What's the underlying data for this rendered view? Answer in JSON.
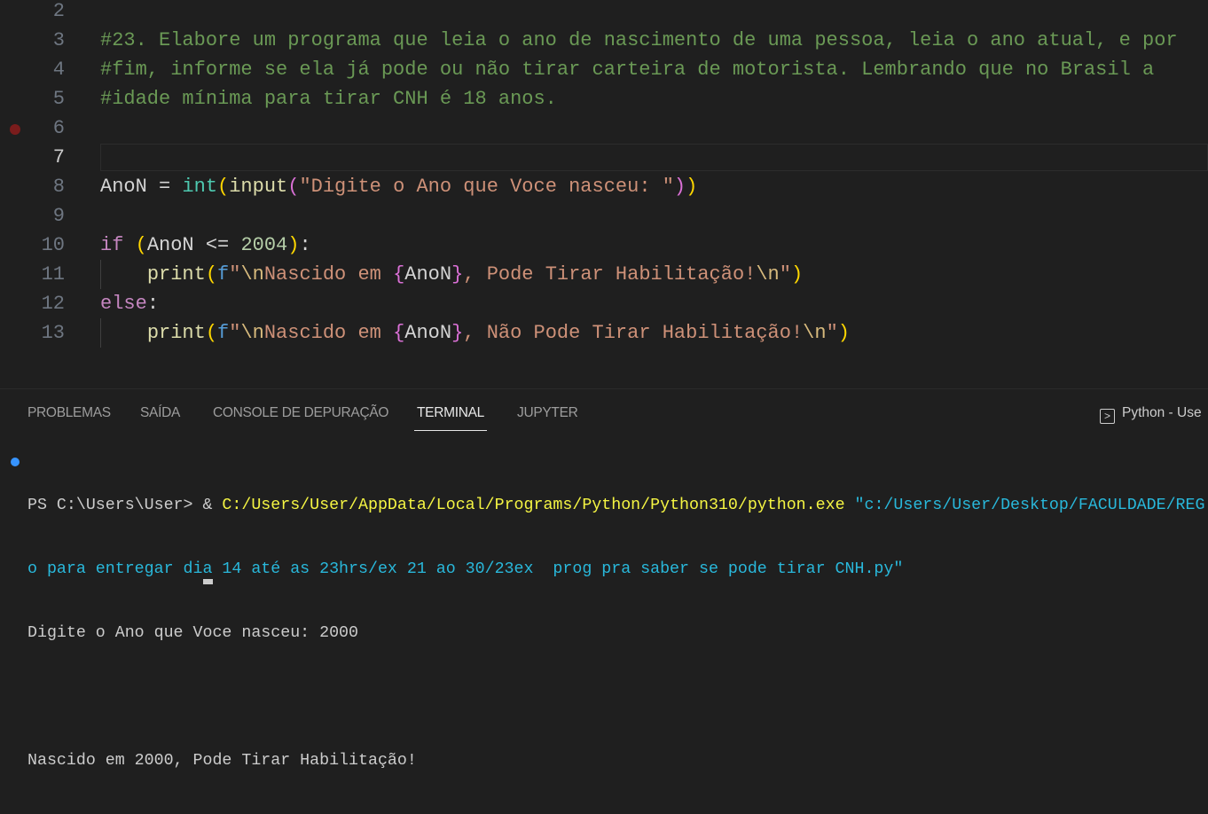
{
  "editor": {
    "active_line": 7,
    "breakpoint_line": 6,
    "lines": [
      {
        "n": "2",
        "tokens": []
      },
      {
        "n": "3",
        "tokens": [
          [
            "#23. Elabore um programa que leia o ano de nascimento de uma pessoa, leia o ano atual, e por",
            "comment"
          ]
        ]
      },
      {
        "n": "4",
        "tokens": [
          [
            "#fim, informe se ela já pode ou não tirar carteira de motorista. Lembrando que no Brasil a",
            "comment"
          ]
        ]
      },
      {
        "n": "5",
        "tokens": [
          [
            "#idade mínima para tirar CNH é 18 anos.",
            "comment"
          ]
        ]
      },
      {
        "n": "6",
        "tokens": []
      },
      {
        "n": "7",
        "tokens": []
      },
      {
        "n": "8",
        "tokens": [
          [
            "AnoN",
            "var"
          ],
          [
            " = ",
            "plain"
          ],
          [
            "int",
            "builtin"
          ],
          [
            "(",
            "b1"
          ],
          [
            "input",
            "func"
          ],
          [
            "(",
            "b2"
          ],
          [
            "\"Digite o Ano que Voce nasceu: \"",
            "str"
          ],
          [
            ")",
            "b2"
          ],
          [
            ")",
            "b1"
          ]
        ]
      },
      {
        "n": "9",
        "tokens": []
      },
      {
        "n": "10",
        "tokens": [
          [
            "if",
            "kw"
          ],
          [
            " ",
            "plain"
          ],
          [
            "(",
            "b1"
          ],
          [
            "AnoN",
            "var"
          ],
          [
            " <= ",
            "plain"
          ],
          [
            "2004",
            "num"
          ],
          [
            ")",
            "b1"
          ],
          [
            ":",
            "plain"
          ]
        ]
      },
      {
        "n": "11",
        "tokens": [
          [
            "    ",
            "plain"
          ],
          [
            "print",
            "func"
          ],
          [
            "(",
            "b1"
          ],
          [
            "f",
            "fpre"
          ],
          [
            "\"",
            "str"
          ],
          [
            "\\n",
            "esc"
          ],
          [
            "Nascido em ",
            "str"
          ],
          [
            "{",
            "b2"
          ],
          [
            "AnoN",
            "var"
          ],
          [
            "}",
            "b2"
          ],
          [
            ", Pode Tirar Habilitação!",
            "str"
          ],
          [
            "\\n",
            "esc"
          ],
          [
            "\"",
            "str"
          ],
          [
            ")",
            "b1"
          ]
        ]
      },
      {
        "n": "12",
        "tokens": [
          [
            "else",
            "kw"
          ],
          [
            ":",
            "plain"
          ]
        ]
      },
      {
        "n": "13",
        "tokens": [
          [
            "    ",
            "plain"
          ],
          [
            "print",
            "func"
          ],
          [
            "(",
            "b1"
          ],
          [
            "f",
            "fpre"
          ],
          [
            "\"",
            "str"
          ],
          [
            "\\n",
            "esc"
          ],
          [
            "Nascido em ",
            "str"
          ],
          [
            "{",
            "b2"
          ],
          [
            "AnoN",
            "var"
          ],
          [
            "}",
            "b2"
          ],
          [
            ", Não Pode Tirar Habilitação!",
            "str"
          ],
          [
            "\\n",
            "esc"
          ],
          [
            "\"",
            "str"
          ],
          [
            ")",
            "b1"
          ]
        ]
      }
    ]
  },
  "panel": {
    "tabs": [
      {
        "label": "PROBLEMAS",
        "active": false
      },
      {
        "label": "SAÍDA",
        "active": false
      },
      {
        "label": "CONSOLE DE DEPURAÇÃO",
        "active": false
      },
      {
        "label": "TERMINAL",
        "active": true
      },
      {
        "label": "JUPYTER",
        "active": false
      }
    ],
    "terminal_selector": {
      "icon": "terminal-icon",
      "label": "Python - Use"
    },
    "terminal": {
      "prompt": "PS C:\\Users\\User> & ",
      "exe": "C:/Users/User/AppData/Local/Programs/Python/Python310/python.exe",
      "arg_line1": " \"c:/Users/User/Desktop/FACULDADE/REG",
      "arg_line2": "o para entregar dia 14 até as 23hrs/ex 21 ao 30/23ex  prog pra saber se pode tirar CNH.py\"",
      "output": [
        "Digite o Ano que Voce nasceu: 2000",
        "",
        "Nascido em 2000, Pode Tirar Habilitação!"
      ]
    }
  }
}
